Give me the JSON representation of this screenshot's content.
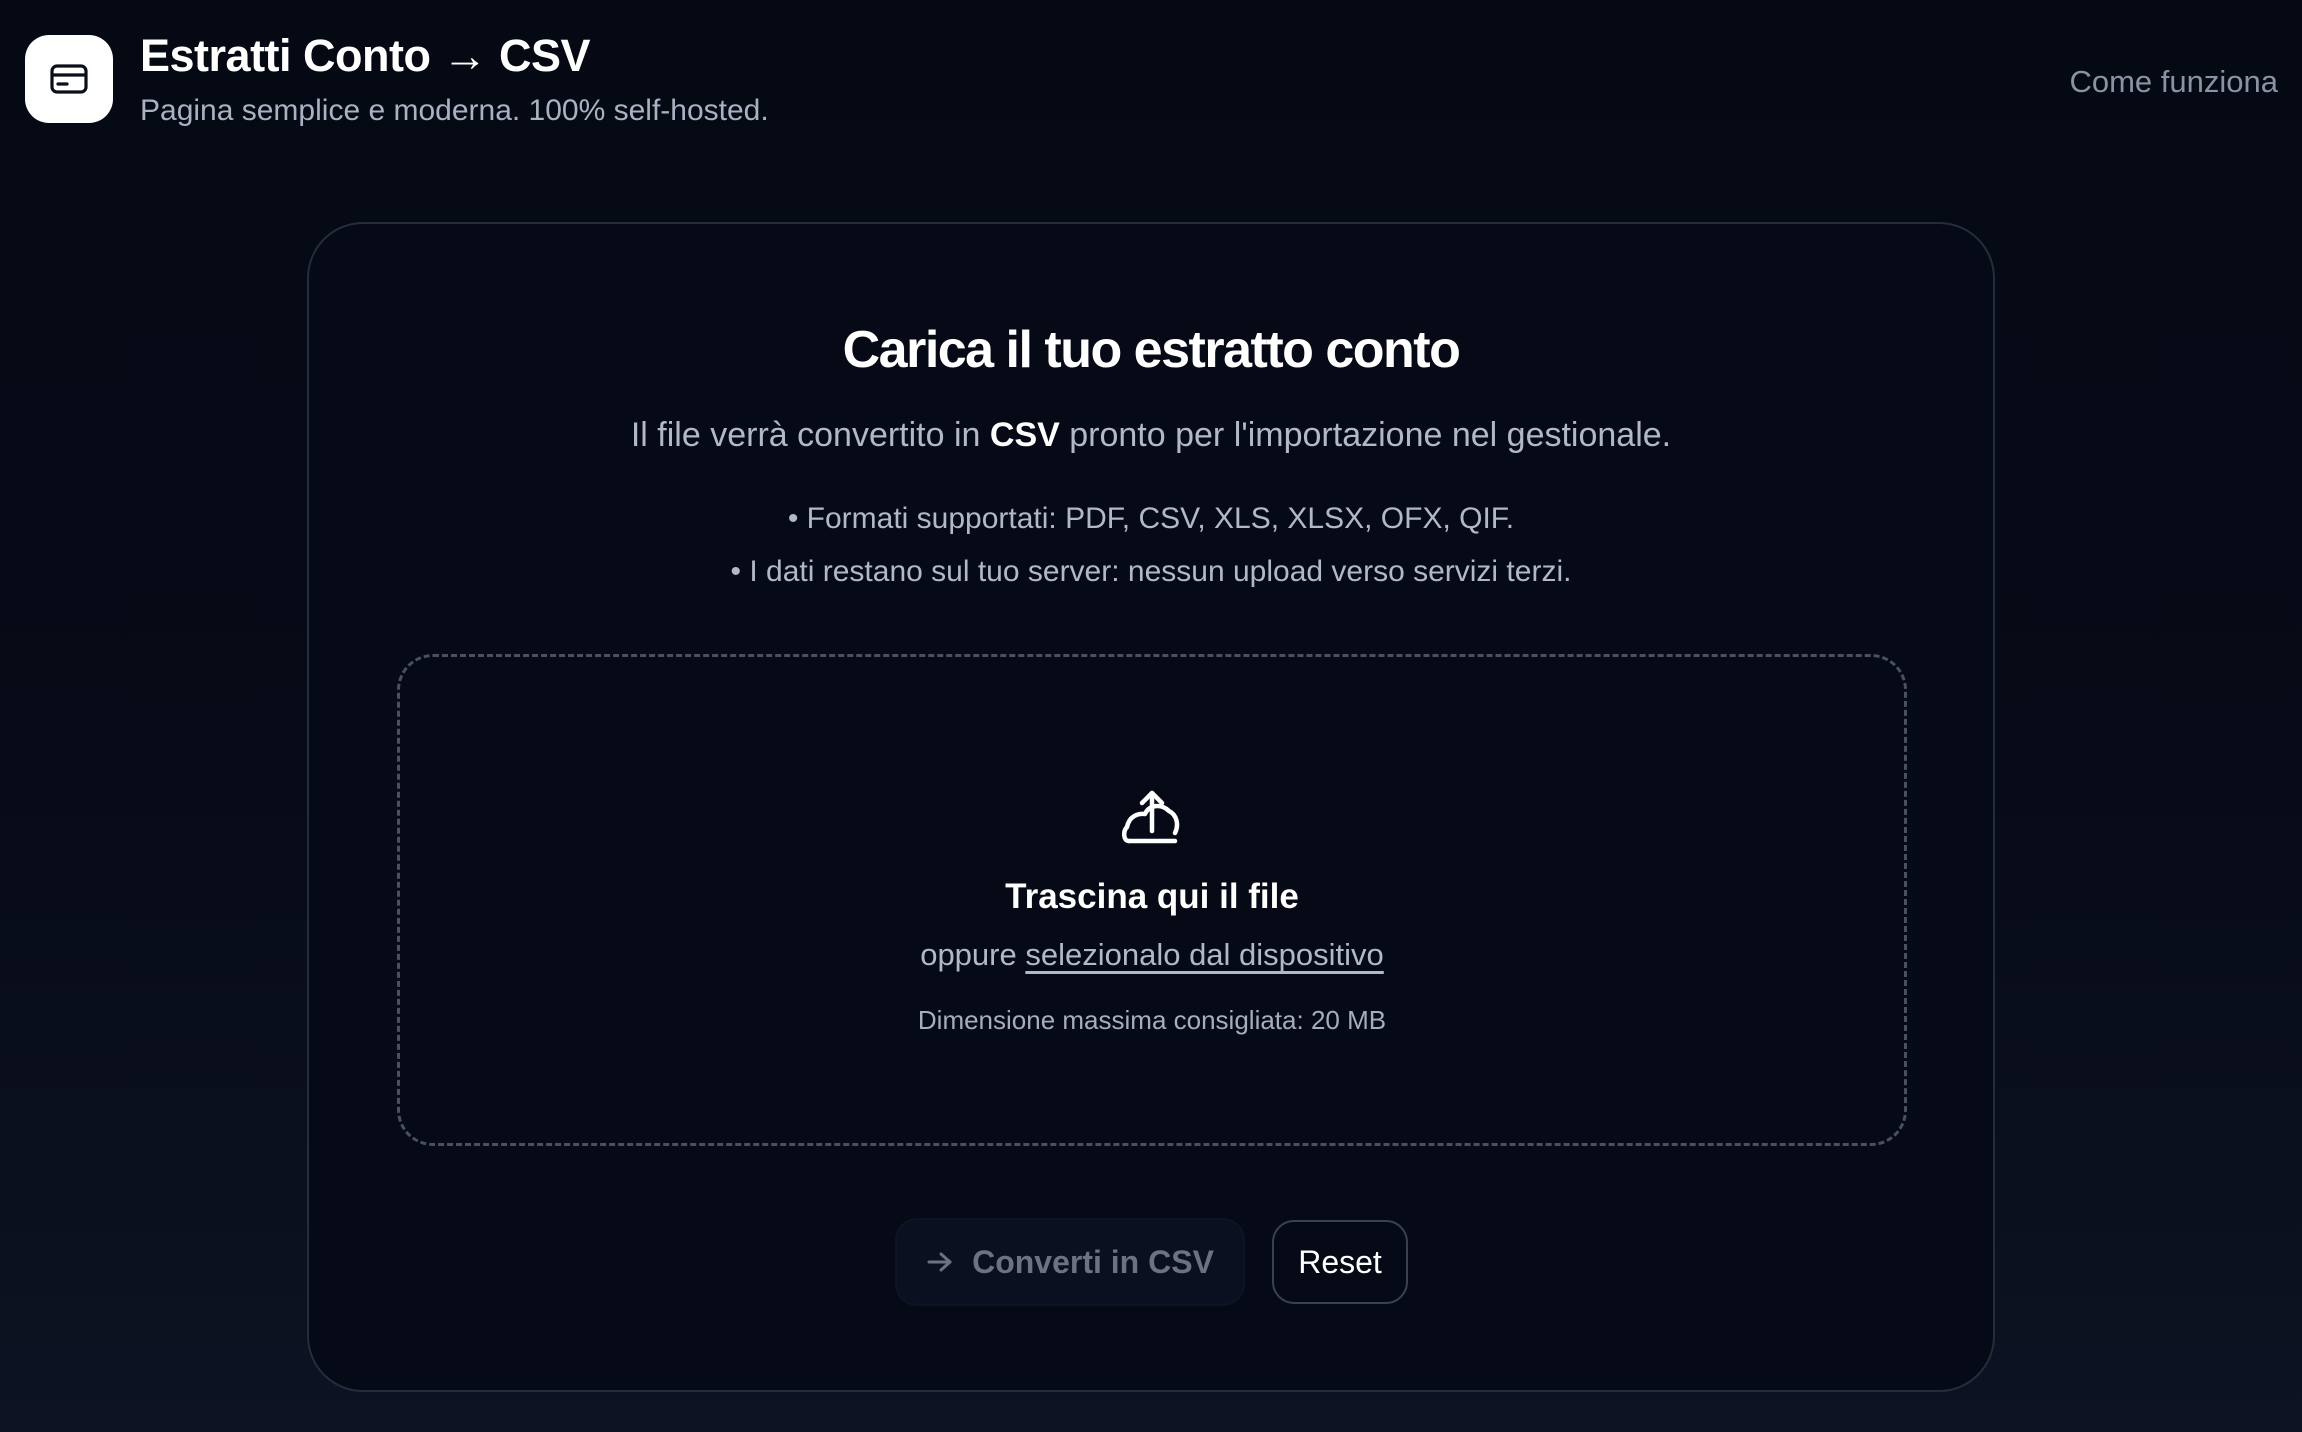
{
  "header": {
    "logo_icon": "credit-card-icon",
    "title": "Estratti Conto → CSV",
    "subtitle": "Pagina semplice e moderna. 100% self-hosted.",
    "nav_link": "Come funziona"
  },
  "card": {
    "title": "Carica il tuo estratto conto",
    "desc_before": "Il file verrà convertito in ",
    "desc_strong": "CSV",
    "desc_after": " pronto per l'importazione nel gestionale.",
    "bullets": [
      "• Formati supportati: PDF, CSV, XLS, XLSX, OFX, QIF.",
      "• I dati restano sul tuo server: nessun upload verso servizi terzi."
    ]
  },
  "dropzone": {
    "icon": "upload-cloud-icon",
    "title": "Trascina qui il file",
    "or_text": "oppure ",
    "select_link": "selezionalo dal dispositivo",
    "hint": "Dimensione massima consigliata: 20 MB"
  },
  "actions": {
    "convert_icon": "arrow-right-icon",
    "convert_label": "Converti in CSV",
    "reset_label": "Reset"
  },
  "colors": {
    "background": "#050914",
    "card_border": "#252c3b",
    "muted_text": "#b2b8c6",
    "disabled_text": "#6c7282"
  }
}
